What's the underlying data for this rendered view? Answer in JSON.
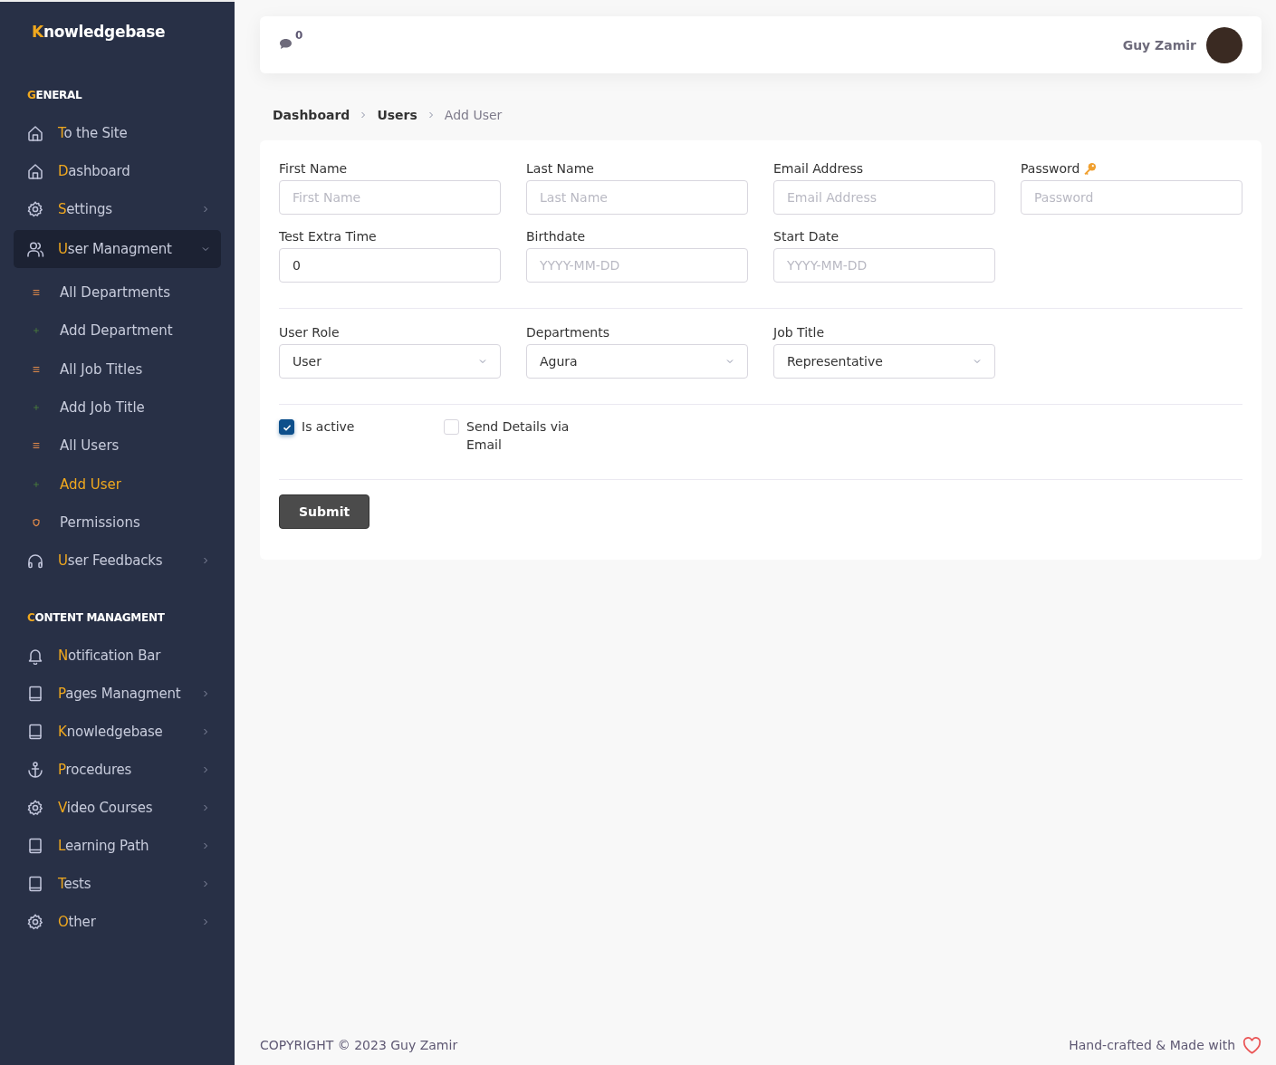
{
  "sidebar": {
    "brand": "Knowledgebase",
    "sections": [
      {
        "heading": "GENERAL",
        "items": [
          {
            "label": "To the Site",
            "kind": "home",
            "submenu": false,
            "expanded": false
          },
          {
            "label": "Dashboard",
            "kind": "home",
            "submenu": false,
            "expanded": false
          },
          {
            "label": "Settings",
            "kind": "gear",
            "submenu": true,
            "expanded": false
          },
          {
            "label": "User Managment",
            "kind": "users",
            "submenu": true,
            "expanded": true,
            "children": [
              {
                "label": "All Departments",
                "kind": "list",
                "selected": false
              },
              {
                "label": "Add Department",
                "kind": "plus",
                "selected": false
              },
              {
                "label": "All Job Titles",
                "kind": "list",
                "selected": false
              },
              {
                "label": "Add Job Title",
                "kind": "plus",
                "selected": false
              },
              {
                "label": "All Users",
                "kind": "list",
                "selected": false
              },
              {
                "label": "Add User",
                "kind": "plus",
                "selected": true
              },
              {
                "label": "Permissions",
                "kind": "shield",
                "selected": false
              }
            ]
          },
          {
            "label": "User Feedbacks",
            "kind": "headphones",
            "submenu": true,
            "expanded": false
          }
        ]
      },
      {
        "heading": "CONTENT MANAGMENT",
        "items": [
          {
            "label": "Notification Bar",
            "kind": "bell",
            "submenu": false,
            "expanded": false
          },
          {
            "label": "Pages Managment",
            "kind": "book",
            "submenu": true,
            "expanded": false
          },
          {
            "label": "Knowledgebase",
            "kind": "book",
            "submenu": true,
            "expanded": false
          },
          {
            "label": "Procedures",
            "kind": "anchor",
            "submenu": true,
            "expanded": false
          },
          {
            "label": "Video Courses",
            "kind": "gear",
            "submenu": true,
            "expanded": false
          },
          {
            "label": "Learning Path",
            "kind": "book",
            "submenu": true,
            "expanded": false
          },
          {
            "label": "Tests",
            "kind": "book",
            "submenu": true,
            "expanded": false
          },
          {
            "label": "Other",
            "kind": "gear",
            "submenu": true,
            "expanded": false
          }
        ]
      }
    ]
  },
  "header": {
    "message_count": "0",
    "user_name": "Guy Zamir"
  },
  "breadcrumb": [
    {
      "label": "Dashboard",
      "current": false
    },
    {
      "label": "Users",
      "current": false
    },
    {
      "label": "Add User",
      "current": true
    }
  ],
  "form": {
    "groups": [
      {
        "fields": [
          {
            "label": "First Name",
            "kind": "text",
            "placeholder": "First Name"
          },
          {
            "label": "Last Name",
            "kind": "text",
            "placeholder": "Last Name"
          },
          {
            "label": "Email Address",
            "kind": "text",
            "placeholder": "Email Address"
          },
          {
            "label": "Password",
            "kind": "password",
            "placeholder": "Password"
          },
          {
            "label": "Test Extra Time",
            "kind": "text",
            "value": "0"
          },
          {
            "label": "Birthdate",
            "kind": "text",
            "placeholder": "YYYY-MM-DD"
          },
          {
            "label": "Start Date",
            "kind": "text",
            "placeholder": "YYYY-MM-DD"
          }
        ]
      },
      {
        "fields": [
          {
            "label": "User Role",
            "kind": "select",
            "value": "User"
          },
          {
            "label": "Departments",
            "kind": "select",
            "value": "Agura"
          },
          {
            "label": "Job Title",
            "kind": "select",
            "value": "Representative"
          }
        ]
      }
    ],
    "checkboxes": [
      {
        "label": "Is active",
        "checked": true
      },
      {
        "label": "Send Details via Email",
        "checked": false
      }
    ],
    "submit": "Submit"
  },
  "footer": {
    "copyright": "COPYRIGHT © 2023 Guy Zamir",
    "credit": "Hand-crafted & Made with"
  }
}
